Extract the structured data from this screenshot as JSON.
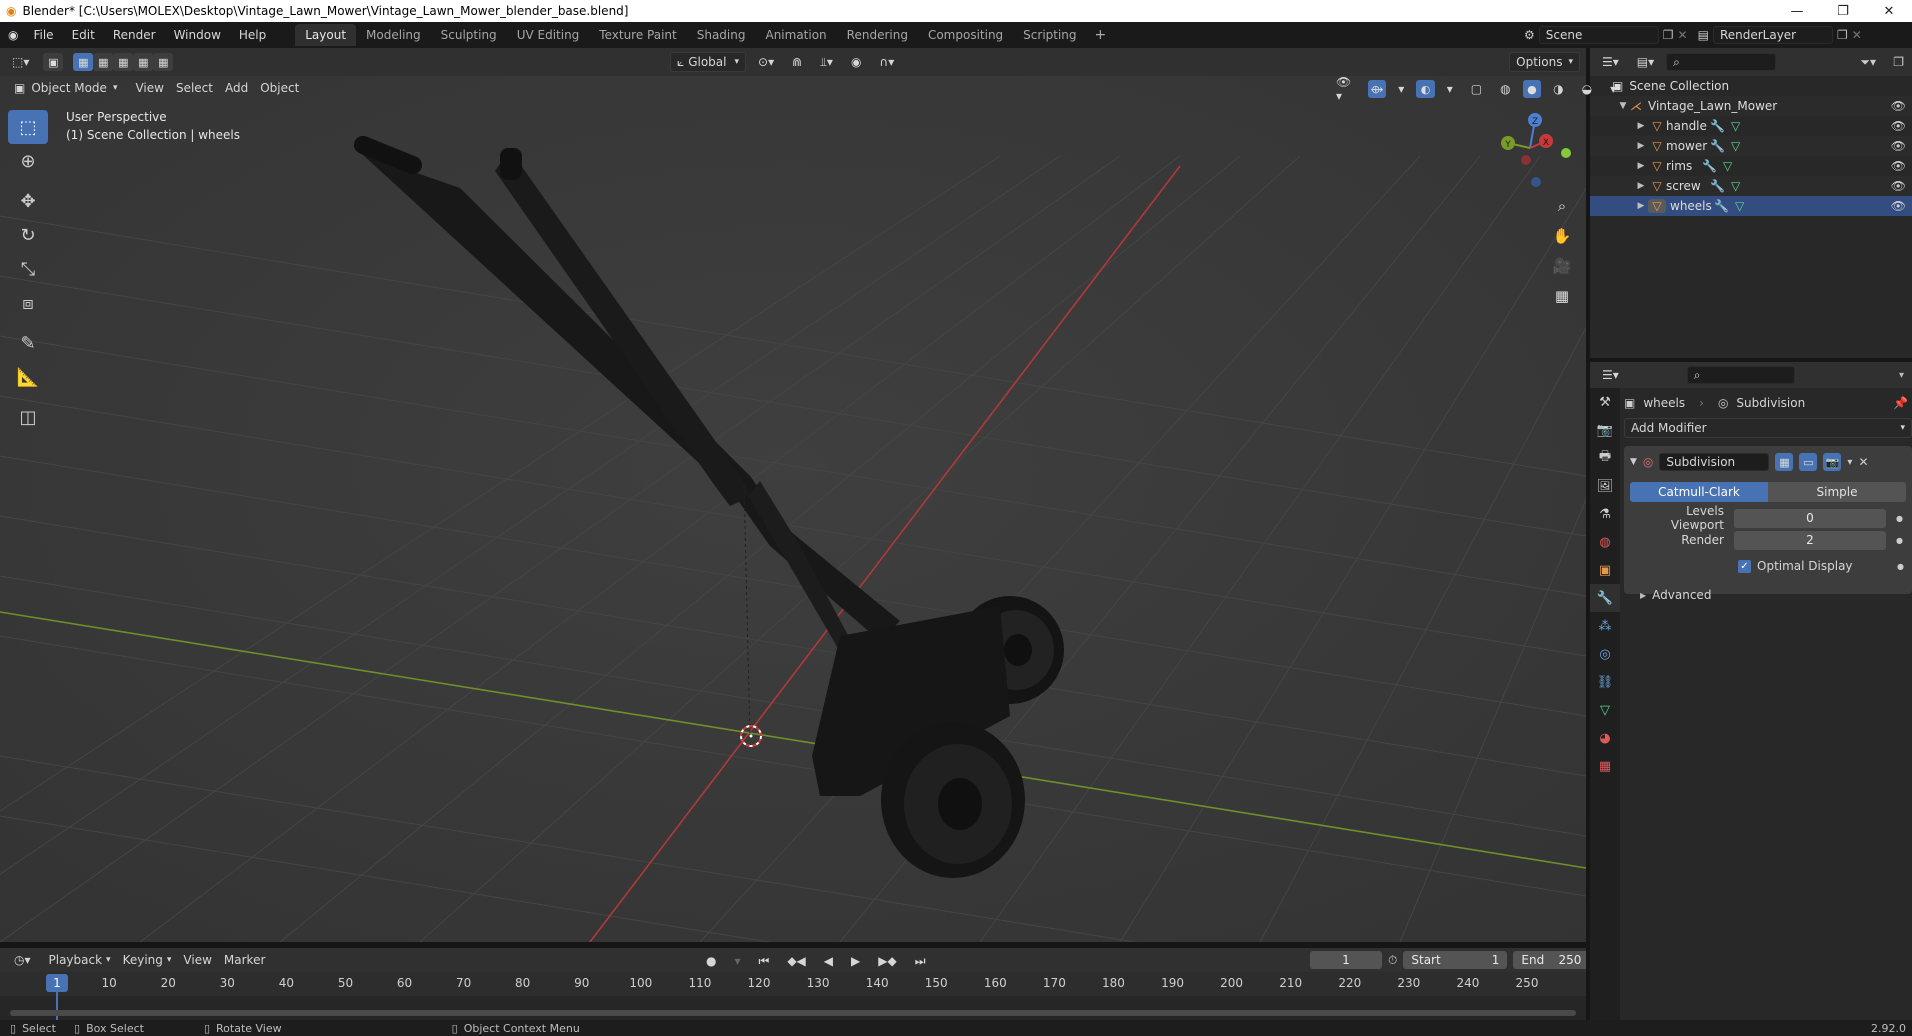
{
  "window": {
    "title": "Blender* [C:\\Users\\MOLEX\\Desktop\\Vintage_Lawn_Mower\\Vintage_Lawn_Mower_blender_base.blend]"
  },
  "menu": {
    "items": [
      "File",
      "Edit",
      "Render",
      "Window",
      "Help"
    ],
    "workspaces": [
      "Layout",
      "Modeling",
      "Sculpting",
      "UV Editing",
      "Texture Paint",
      "Shading",
      "Animation",
      "Rendering",
      "Compositing",
      "Scripting"
    ],
    "active_workspace": "Layout",
    "scene": "Scene",
    "render_layer": "RenderLayer"
  },
  "viewport_header": {
    "mode": "Object Mode",
    "menus": [
      "View",
      "Select",
      "Add",
      "Object"
    ],
    "transform_orientation": "Global",
    "options_label": "Options"
  },
  "viewport": {
    "perspective_label": "User Perspective",
    "collection_label": "(1) Scene Collection | wheels",
    "gizmo": {
      "x": "X",
      "y": "Y",
      "z": "Z"
    }
  },
  "outliner": {
    "root": "Scene Collection",
    "collection": "Vintage_Lawn_Mower",
    "objects": [
      "handle",
      "mower",
      "rims",
      "screw",
      "wheels"
    ],
    "active_object": "wheels"
  },
  "properties": {
    "breadcrumb_object": "wheels",
    "breadcrumb_modifier": "Subdivision",
    "add_modifier_label": "Add Modifier",
    "modifier_name": "Subdivision",
    "subdiv_types": [
      "Catmull-Clark",
      "Simple"
    ],
    "active_subdiv_type": "Catmull-Clark",
    "levels_viewport_label": "Levels Viewport",
    "levels_viewport_value": "0",
    "render_label": "Render",
    "render_value": "2",
    "optimal_display_label": "Optimal Display",
    "optimal_display_checked": true,
    "advanced_label": "Advanced"
  },
  "timeline": {
    "menus": [
      "Playback",
      "Keying",
      "View",
      "Marker"
    ],
    "current_frame": "1",
    "start_label": "Start",
    "start_value": "1",
    "end_label": "End",
    "end_value": "250",
    "ticks": [
      "10",
      "20",
      "30",
      "40",
      "50",
      "60",
      "70",
      "80",
      "90",
      "100",
      "110",
      "120",
      "130",
      "140",
      "150",
      "160",
      "170",
      "180",
      "190",
      "200",
      "210",
      "220",
      "230",
      "240",
      "250"
    ],
    "playhead_label": "1"
  },
  "statusbar": {
    "select": "Select",
    "box_select": "Box Select",
    "rotate_view": "Rotate View",
    "context_menu": "Object Context Menu",
    "version": "2.92.0"
  },
  "colors": {
    "accent": "#4772b3",
    "x_axis": "#c83a3a",
    "y_axis": "#7a9a2a",
    "object_orange": "#e59a4a",
    "mesh_green": "#5fd68f"
  }
}
